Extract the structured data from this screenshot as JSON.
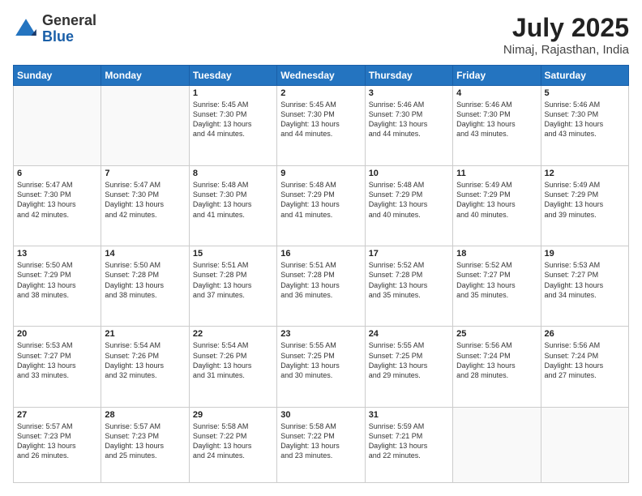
{
  "header": {
    "logo_general": "General",
    "logo_blue": "Blue",
    "month_year": "July 2025",
    "location": "Nimaj, Rajasthan, India"
  },
  "days_of_week": [
    "Sunday",
    "Monday",
    "Tuesday",
    "Wednesday",
    "Thursday",
    "Friday",
    "Saturday"
  ],
  "weeks": [
    [
      {
        "day": "",
        "info": ""
      },
      {
        "day": "",
        "info": ""
      },
      {
        "day": "1",
        "info": "Sunrise: 5:45 AM\nSunset: 7:30 PM\nDaylight: 13 hours\nand 44 minutes."
      },
      {
        "day": "2",
        "info": "Sunrise: 5:45 AM\nSunset: 7:30 PM\nDaylight: 13 hours\nand 44 minutes."
      },
      {
        "day": "3",
        "info": "Sunrise: 5:46 AM\nSunset: 7:30 PM\nDaylight: 13 hours\nand 44 minutes."
      },
      {
        "day": "4",
        "info": "Sunrise: 5:46 AM\nSunset: 7:30 PM\nDaylight: 13 hours\nand 43 minutes."
      },
      {
        "day": "5",
        "info": "Sunrise: 5:46 AM\nSunset: 7:30 PM\nDaylight: 13 hours\nand 43 minutes."
      }
    ],
    [
      {
        "day": "6",
        "info": "Sunrise: 5:47 AM\nSunset: 7:30 PM\nDaylight: 13 hours\nand 42 minutes."
      },
      {
        "day": "7",
        "info": "Sunrise: 5:47 AM\nSunset: 7:30 PM\nDaylight: 13 hours\nand 42 minutes."
      },
      {
        "day": "8",
        "info": "Sunrise: 5:48 AM\nSunset: 7:30 PM\nDaylight: 13 hours\nand 41 minutes."
      },
      {
        "day": "9",
        "info": "Sunrise: 5:48 AM\nSunset: 7:29 PM\nDaylight: 13 hours\nand 41 minutes."
      },
      {
        "day": "10",
        "info": "Sunrise: 5:48 AM\nSunset: 7:29 PM\nDaylight: 13 hours\nand 40 minutes."
      },
      {
        "day": "11",
        "info": "Sunrise: 5:49 AM\nSunset: 7:29 PM\nDaylight: 13 hours\nand 40 minutes."
      },
      {
        "day": "12",
        "info": "Sunrise: 5:49 AM\nSunset: 7:29 PM\nDaylight: 13 hours\nand 39 minutes."
      }
    ],
    [
      {
        "day": "13",
        "info": "Sunrise: 5:50 AM\nSunset: 7:29 PM\nDaylight: 13 hours\nand 38 minutes."
      },
      {
        "day": "14",
        "info": "Sunrise: 5:50 AM\nSunset: 7:28 PM\nDaylight: 13 hours\nand 38 minutes."
      },
      {
        "day": "15",
        "info": "Sunrise: 5:51 AM\nSunset: 7:28 PM\nDaylight: 13 hours\nand 37 minutes."
      },
      {
        "day": "16",
        "info": "Sunrise: 5:51 AM\nSunset: 7:28 PM\nDaylight: 13 hours\nand 36 minutes."
      },
      {
        "day": "17",
        "info": "Sunrise: 5:52 AM\nSunset: 7:28 PM\nDaylight: 13 hours\nand 35 minutes."
      },
      {
        "day": "18",
        "info": "Sunrise: 5:52 AM\nSunset: 7:27 PM\nDaylight: 13 hours\nand 35 minutes."
      },
      {
        "day": "19",
        "info": "Sunrise: 5:53 AM\nSunset: 7:27 PM\nDaylight: 13 hours\nand 34 minutes."
      }
    ],
    [
      {
        "day": "20",
        "info": "Sunrise: 5:53 AM\nSunset: 7:27 PM\nDaylight: 13 hours\nand 33 minutes."
      },
      {
        "day": "21",
        "info": "Sunrise: 5:54 AM\nSunset: 7:26 PM\nDaylight: 13 hours\nand 32 minutes."
      },
      {
        "day": "22",
        "info": "Sunrise: 5:54 AM\nSunset: 7:26 PM\nDaylight: 13 hours\nand 31 minutes."
      },
      {
        "day": "23",
        "info": "Sunrise: 5:55 AM\nSunset: 7:25 PM\nDaylight: 13 hours\nand 30 minutes."
      },
      {
        "day": "24",
        "info": "Sunrise: 5:55 AM\nSunset: 7:25 PM\nDaylight: 13 hours\nand 29 minutes."
      },
      {
        "day": "25",
        "info": "Sunrise: 5:56 AM\nSunset: 7:24 PM\nDaylight: 13 hours\nand 28 minutes."
      },
      {
        "day": "26",
        "info": "Sunrise: 5:56 AM\nSunset: 7:24 PM\nDaylight: 13 hours\nand 27 minutes."
      }
    ],
    [
      {
        "day": "27",
        "info": "Sunrise: 5:57 AM\nSunset: 7:23 PM\nDaylight: 13 hours\nand 26 minutes."
      },
      {
        "day": "28",
        "info": "Sunrise: 5:57 AM\nSunset: 7:23 PM\nDaylight: 13 hours\nand 25 minutes."
      },
      {
        "day": "29",
        "info": "Sunrise: 5:58 AM\nSunset: 7:22 PM\nDaylight: 13 hours\nand 24 minutes."
      },
      {
        "day": "30",
        "info": "Sunrise: 5:58 AM\nSunset: 7:22 PM\nDaylight: 13 hours\nand 23 minutes."
      },
      {
        "day": "31",
        "info": "Sunrise: 5:59 AM\nSunset: 7:21 PM\nDaylight: 13 hours\nand 22 minutes."
      },
      {
        "day": "",
        "info": ""
      },
      {
        "day": "",
        "info": ""
      }
    ]
  ]
}
